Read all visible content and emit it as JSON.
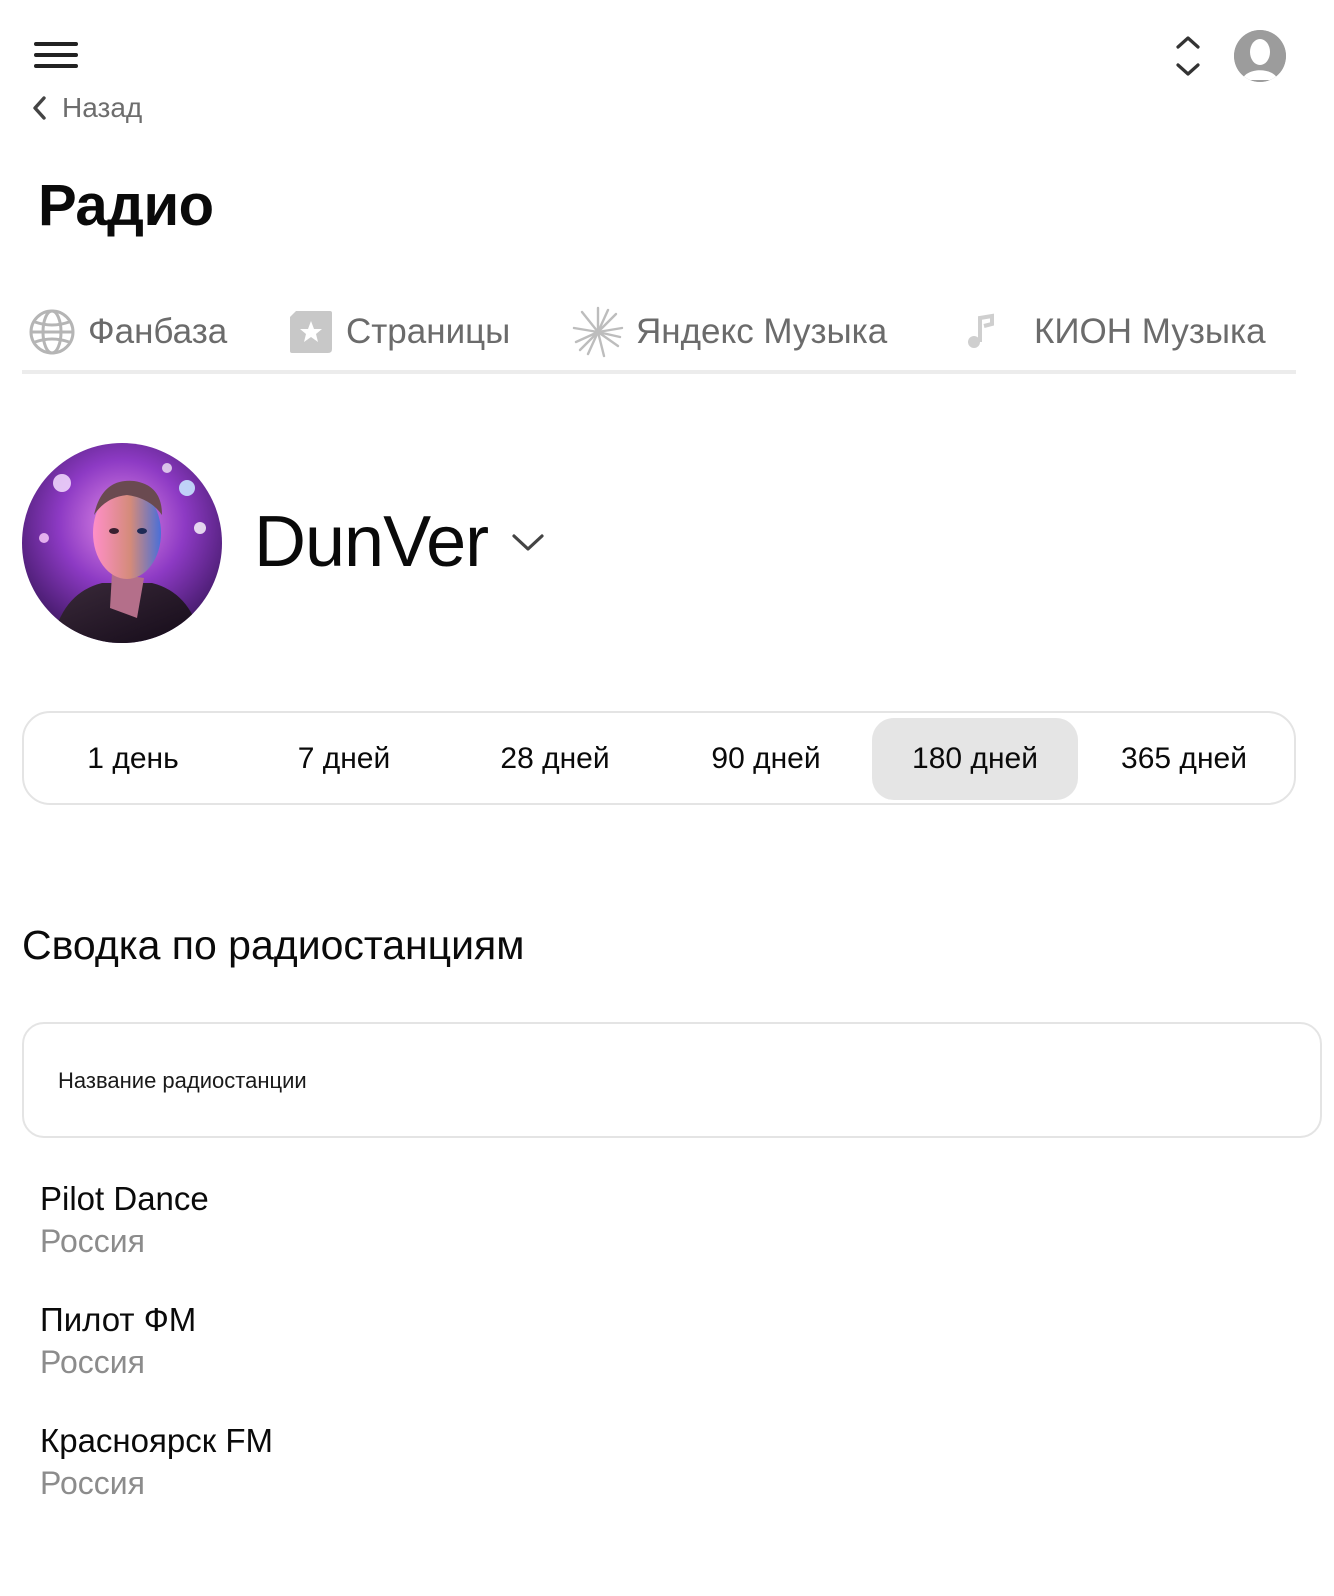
{
  "header": {
    "menu_icon": "hamburger-menu-icon",
    "sort_icon": "chevron-up-down-icon",
    "profile_icon": "user-avatar-icon",
    "back_label": "Назад",
    "title": "Радио"
  },
  "services": {
    "items": [
      {
        "label": "Фанбаза",
        "icon": "globe-icon"
      },
      {
        "label": "Страницы",
        "icon": "star-badge-icon"
      },
      {
        "label": "Яндекс Музыка",
        "icon": "yandex-music-icon"
      },
      {
        "label": "КИОН Музыка",
        "icon": "music-note-icon"
      }
    ]
  },
  "artist": {
    "name": "DunVer",
    "dropdown_icon": "chevron-down-icon"
  },
  "periods": {
    "items": [
      "1 день",
      "7 дней",
      "28 дней",
      "90 дней",
      "180 дней",
      "365 дней"
    ],
    "active_index": 4
  },
  "summary": {
    "title": "Сводка по радиостанциям",
    "column_header": "Название радиостанции",
    "stations": [
      {
        "name": "Pilot Dance",
        "country": "Россия"
      },
      {
        "name": "Пилот ФМ",
        "country": "Россия"
      },
      {
        "name": "Красноярск FM",
        "country": "Россия"
      }
    ]
  },
  "colors": {
    "text_primary": "#0a0a0a",
    "text_muted": "#6b6b6b",
    "text_country": "#8c8c8c",
    "border": "#e4e4e4",
    "active_period_bg": "#e5e5e5"
  }
}
